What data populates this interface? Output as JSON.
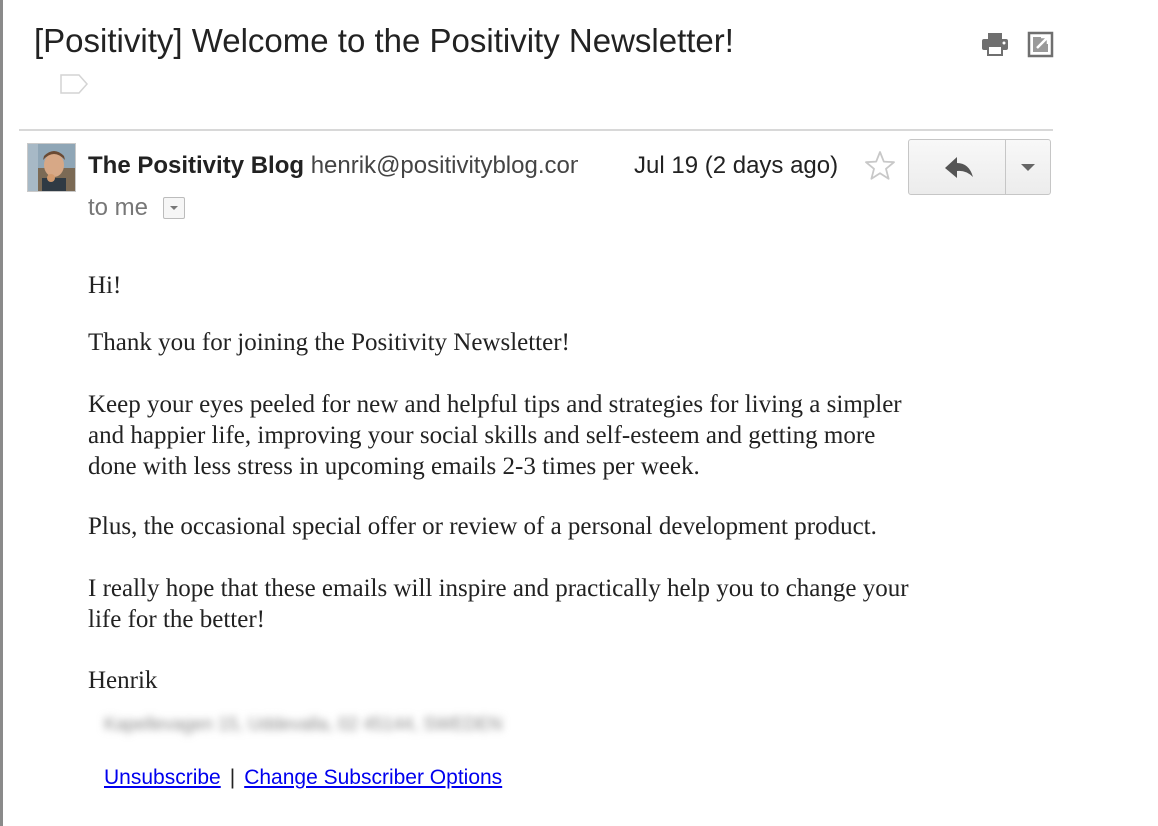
{
  "email": {
    "subject": "[Positivity] Welcome to the Positivity Newsletter!",
    "sender_name": "The Positivity Blog",
    "sender_email": "henrik@positivityblog.com",
    "date": "Jul 19 (2 days ago)",
    "to_label": "to me",
    "body": {
      "greeting": "Hi!",
      "thanks": "Thank you for joining the Positivity Newsletter!",
      "keep_line1": "Keep your eyes peeled for new and helpful tips and strategies for living a simpler",
      "keep_line2": "and happier life, improving your social skills and self-esteem and getting more",
      "keep_line3": "done with less stress in upcoming emails 2-3 times per week.",
      "plus": "Plus, the occasional special offer or review of a personal development product.",
      "hope_line1": "I really hope that these emails will inspire and practically help you to change your",
      "hope_line2": "life for the better!",
      "signature": "Henrik"
    },
    "footer": {
      "address": "Kapellevagen 15, Uddevalla, 02 45144, SWEDEN",
      "unsubscribe": "Unsubscribe",
      "separator": "|",
      "change_options": "Change Subscriber Options"
    }
  },
  "icons": {
    "print": "print-icon",
    "new_window": "open-in-new-window-icon",
    "star": "star-icon",
    "reply": "reply-icon",
    "more": "chevron-down-icon",
    "label": "label-tag-icon"
  }
}
